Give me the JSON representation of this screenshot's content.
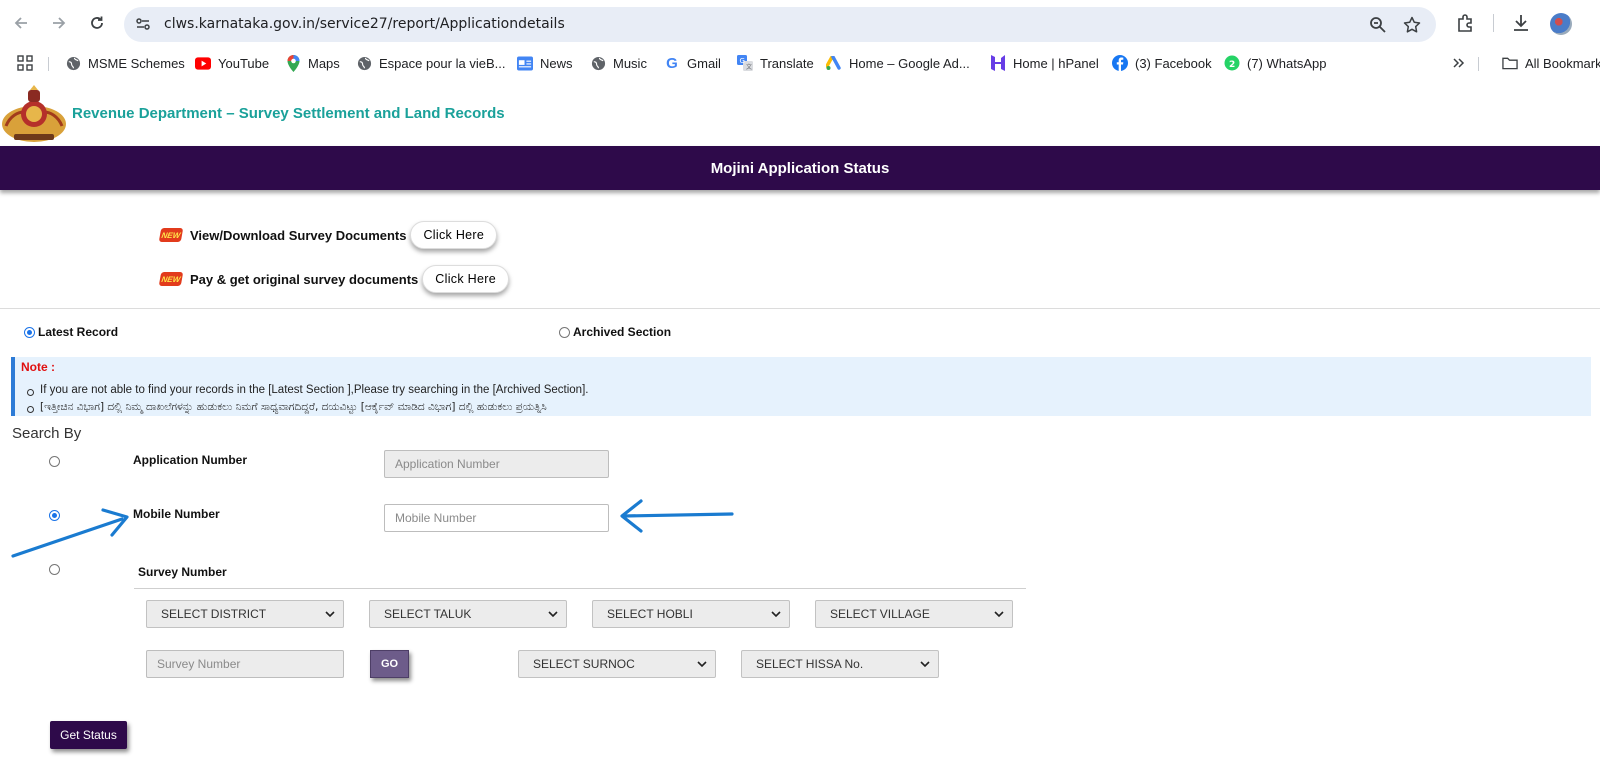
{
  "browser": {
    "url": "clws.karnataka.gov.in/service27/report/Applicationdetails",
    "bookmarks": [
      {
        "label": "MSME Schemes",
        "icon": "globe-icon"
      },
      {
        "label": "YouTube",
        "icon": "youtube-icon"
      },
      {
        "label": "Maps",
        "icon": "maps-icon"
      },
      {
        "label": "Espace pour la vieB...",
        "icon": "globe-icon"
      },
      {
        "label": "News",
        "icon": "news-icon"
      },
      {
        "label": "Music",
        "icon": "globe-icon"
      },
      {
        "label": "Gmail",
        "icon": "google-icon"
      },
      {
        "label": "Translate",
        "icon": "translate-icon"
      },
      {
        "label": "Home – Google Ad...",
        "icon": "google-ads-icon"
      },
      {
        "label": "Home | hPanel",
        "icon": "hostinger-icon"
      },
      {
        "label": "(3) Facebook",
        "icon": "facebook-icon"
      },
      {
        "label": "(7) WhatsApp",
        "icon": "whatsapp-icon"
      }
    ],
    "all_bookmarks": "All Bookmarks"
  },
  "header": {
    "dept_title": "Revenue Department – Survey Settlement and Land Records",
    "banner_title": "Mojini Application Status"
  },
  "documents": [
    {
      "label": "View/Download Survey Documents",
      "button": "Click Here",
      "badge": "NEW"
    },
    {
      "label": "Pay & get original survey documents",
      "button": "Click Here",
      "badge": "NEW"
    }
  ],
  "record_type": {
    "latest": "Latest Record",
    "archived": "Archived Section",
    "selected": "latest"
  },
  "note": {
    "title": "Note :",
    "items": [
      "If you are not able to find your records in the [Latest Section ],Please try searching in the [Archived Section].",
      "[ಇತ್ತೀಚಿನ ವಿಭಾಗ] ದಲ್ಲಿ ನಿಮ್ಮ ದಾಖಲೆಗಳನ್ನು ಹುಡುಕಲು ನಿಮಗೆ ಸಾಧ್ಯವಾಗದಿದ್ದರೆ, ದಯವಿಟ್ಟು [ಆರ್ಕೈವ್ ಮಾಡಿದ ವಿಭಾಗ] ದಲ್ಲಿ ಹುಡುಕಲು ಪ್ರಯತ್ನಿಸಿ"
    ]
  },
  "search": {
    "heading": "Search By",
    "selected": "mobile",
    "application_label": "Application Number",
    "application_placeholder": "Application Number",
    "mobile_label": "Mobile Number",
    "mobile_placeholder": "Mobile Number",
    "survey_label": "Survey Number",
    "district": "SELECT DISTRICT",
    "taluk": "SELECT TALUK",
    "hobli": "SELECT HOBLI",
    "village": "SELECT VILLAGE",
    "survey_placeholder": "Survey Number",
    "go": "GO",
    "surnoc": "SELECT SURNOC",
    "hissa": "SELECT HISSA No."
  },
  "get_status": "Get Status",
  "colors": {
    "banner": "#2e0a4a",
    "dept_title": "#1aa19a",
    "note_bg": "#e6f2fd",
    "annotation_arrow": "#1a7bd0"
  }
}
